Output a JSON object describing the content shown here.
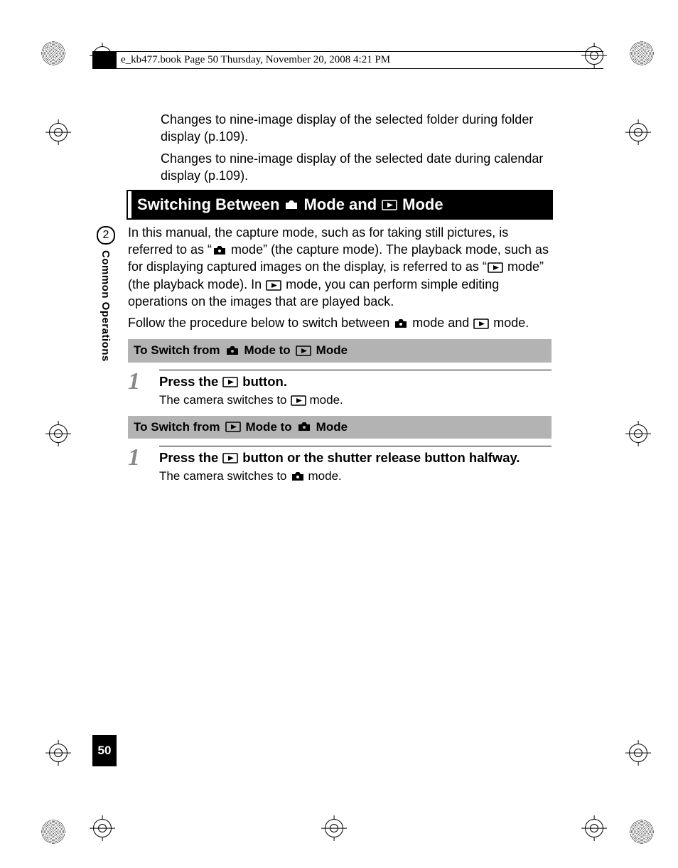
{
  "header": {
    "running_head": "e_kb477.book  Page 50  Thursday, November 20, 2008  4:21 PM"
  },
  "sidebar": {
    "chapter_number": "2",
    "section_label": "Common Operations"
  },
  "page_number": "50",
  "intro": {
    "para1": "Changes to nine-image display of the selected folder during folder display (p.109).",
    "para2": "Changes to nine-image display of the selected date during calendar display (p.109)."
  },
  "heading": {
    "pre": "Switching Between ",
    "mid": " Mode and ",
    "post": " Mode"
  },
  "body": {
    "p1_a": "In this manual, the capture mode, such as for taking still pictures, is referred to as “",
    "p1_b": " mode” (the capture mode). The playback mode, such as for displaying captured images on the display, is referred to as “",
    "p1_c": " mode” (the playback mode). In ",
    "p1_d": " mode, you can perform simple editing operations on the images that are played back.",
    "p2_a": "Follow the procedure below to switch between ",
    "p2_b": " mode and ",
    "p2_c": " mode."
  },
  "sub1": {
    "pre": "To Switch from ",
    "mid": " Mode to ",
    "post": " Mode"
  },
  "step1": {
    "num": "1",
    "title_a": "Press the ",
    "title_b": " button.",
    "text_a": "The camera switches to ",
    "text_b": " mode."
  },
  "sub2": {
    "pre": "To Switch from ",
    "mid": " Mode to ",
    "post": " Mode"
  },
  "step2": {
    "num": "1",
    "title_a": "Press the ",
    "title_b": " button or the shutter release button halfway.",
    "text_a": "The camera switches to ",
    "text_b": " mode."
  }
}
